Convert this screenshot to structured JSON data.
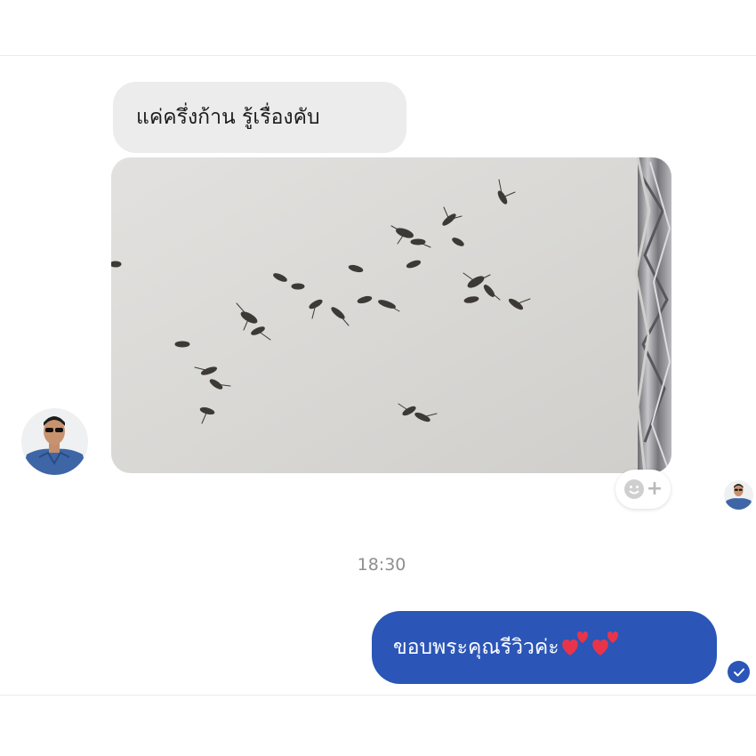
{
  "conversation": {
    "incoming_message": "แค่ครึ่งก้าน รู้เรื่องคับ",
    "timestamp": "18:30",
    "outgoing_message": "ขอบพระคุณรีวิวค่ะ",
    "outgoing_emoji": "💕💕"
  },
  "colors": {
    "incoming_bubble": "#ececec",
    "outgoing_bubble": "#2b55b7",
    "timestamp": "#8f8f8f"
  },
  "icons": {
    "react": "smiley-add-icon",
    "read_receipt": "checkmark-icon"
  }
}
